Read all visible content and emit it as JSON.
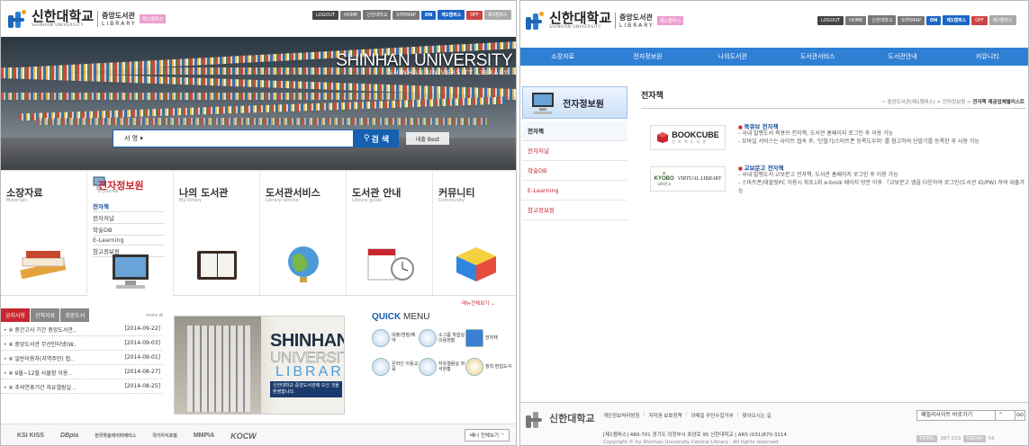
{
  "left": {
    "logo": {
      "kr": "신한대학교",
      "en": "SHINHAN UNIVERSITY",
      "lib_kr": "중앙도서관",
      "lib_en": "LIBRARY",
      "campus": "제1캠퍼스"
    },
    "topbar": {
      "logout": "LOGOUT",
      "home": "HOME",
      "univ": "신한대학교",
      "sitemap": "SITEMAP",
      "on": "ON",
      "campus1": "제1캠퍼스",
      "off": "OFF",
      "campus2": "제2캠퍼스"
    },
    "hero": {
      "title": "SHINHAN UNIVERSITY",
      "subtitle": "SHINHAN UNIVERSITY LIBRARY"
    },
    "search": {
      "select": "서 명",
      "button": "검 색",
      "best": "대출 Best"
    },
    "categories": [
      {
        "title": "소장자료",
        "en": "Materials"
      },
      {
        "title": "전자정보원",
        "en": "E-Journal"
      },
      {
        "title": "나의 도서관",
        "en": "My library"
      },
      {
        "title": "도서관서비스",
        "en": "Library service"
      },
      {
        "title": "도서관 안내",
        "en": "Library guide"
      },
      {
        "title": "커뮤니티",
        "en": "Community"
      }
    ],
    "submenu": [
      "전자책",
      "전자저널",
      "학술DB",
      "E-Learning",
      "참고정보원"
    ],
    "menu_all": "메뉴전체보기",
    "notice": {
      "tabs": [
        "공지사항",
        "신착자료",
        "희망도서"
      ],
      "more": "more",
      "rows": [
        {
          "title": "※ 중간고사 기간 중앙도서관..",
          "date": "[2014-09-22]"
        },
        {
          "title": "※ 중앙도서관 무선인터넷(W..",
          "date": "[2014-09-03]"
        },
        {
          "title": "※ 일반이용자(지역주민) 접..",
          "date": "[2014-09-01]"
        },
        {
          "title": "※ 9월~12월 사물함 이용..",
          "date": "[2014-08-27]"
        },
        {
          "title": "※ 추석연휴기간 자유열람실 ..",
          "date": "[2014-08-25]"
        }
      ]
    },
    "banner": {
      "l1": "SHINHAN",
      "l2": "UNIVERSITY",
      "l3": "LIBRARY",
      "caption": "신한대학교 중앙도서관에 오신 것을 환영합니다."
    },
    "quick": {
      "title_bold": "QUICK",
      "title_rest": " MENU",
      "items": [
        "대출/연장/예약",
        "소그룹 학습실 이용현황",
        "전자책",
        "온라인 이용교육",
        "자유열람실 좌석현황",
        "월칙 편집도서"
      ]
    },
    "footer_logos": [
      "KSI KISS",
      "DBpia",
      "한국학술데이터베이스",
      "국가지식포털",
      "MMPIA",
      "KOCW"
    ],
    "banner_all": "배너 전체보기"
  },
  "right": {
    "logo": {
      "kr": "신한대학교",
      "en": "SHINHAN UNIVERSITY",
      "lib_kr": "중앙도서관",
      "lib_en": "LIBRARY",
      "campus": "제1캠퍼스"
    },
    "topbar": {
      "logout": "LOGOUT",
      "home": "HOME",
      "univ": "신한대학교",
      "sitemap": "SITEMAP",
      "on": "ON",
      "campus1": "제1캠퍼스",
      "off": "OFF",
      "campus2": "제2캠퍼스"
    },
    "nav": [
      "소장자료",
      "전자정보원",
      "나의도서관",
      "도서관서비스",
      "도서관안내",
      "커뮤니티"
    ],
    "side": {
      "title": "전자정보원",
      "items": [
        "전자책",
        "전자저널",
        "학술DB",
        "E-Learning",
        "참고정보원"
      ]
    },
    "page_title": "전자책",
    "breadcrumb": {
      "path": "~ 중앙도서관(제1캠퍼스) > 전자정보원 > ",
      "current": "전자책 제공업체별리스트"
    },
    "entries": [
      {
        "logo": "BOOKCUBE",
        "logo_sub": "전 자 책 도 서 관",
        "title": "북큐브 전자책",
        "desc": [
          "- 국내 발행도서 북큐브 전자책, 도서관 홈페이지 로그인 후 이용 가능",
          "- 모바일 서비스는 사이트 접속 후, '단말기/스마트폰 등록도우미' 를 참고하여 단말기를 등록한 후 사용 가능"
        ]
      },
      {
        "logo": "KYOBO",
        "logo_sub": "VIRTUAL LIBRARY",
        "logo_kr": "교보문고",
        "title": "교보문고 전자책",
        "desc": [
          "- 국내 발행도서 교보문고 전자책, 도서관 홈페이지 로그인 후 이용 가능",
          "- 스마트폰/태블릿PC 이용시 최초1회 e-book 페이지 방문 이후 『교보문고 앱을 다운하여 로그인(도서관 ID/PW) 하여 대출가능"
        ]
      }
    ],
    "footer": {
      "logo_kr": "신한대학교",
      "links": [
        "개인정보처리방침",
        "저작권 보호정책",
        "이메일 무단수집거부",
        "찾아오시는 길"
      ],
      "address": "[제1캠퍼스] 480-701 경기도 의정부시 호암로 95 신한대학교 | ARS (031)870-3114",
      "copyright": "Copyright © by Shinhan University Central Library . All rights reserved",
      "family_site": "패밀리사이트 바로가기",
      "go": "GO",
      "total_label": "TOTAL",
      "total": "387,533",
      "today_label": "TODAY",
      "today": "56"
    }
  }
}
